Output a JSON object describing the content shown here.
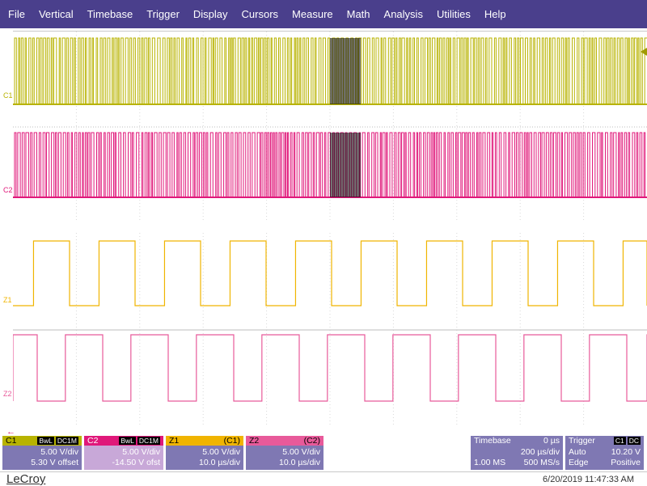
{
  "menu": [
    "File",
    "Vertical",
    "Timebase",
    "Trigger",
    "Display",
    "Cursors",
    "Measure",
    "Math",
    "Analysis",
    "Utilities",
    "Help"
  ],
  "colors": {
    "menubar": "#4a3f8c",
    "c1": "#b8b300",
    "c2": "#e0187a",
    "z1": "#f0b400",
    "z2": "#e85a9a",
    "box_body": "#7f78b3"
  },
  "traces": {
    "c1_label": "C1",
    "c2_label": "C2",
    "z1_label": "Z1",
    "z2_label": "Z2"
  },
  "icons": {
    "trigger_level_marker": "triangle-left-icon",
    "trigger_position_marker": "triangle-up-icon",
    "left_arrow": "arrow-left-icon"
  },
  "status": {
    "c1": {
      "name": "C1",
      "tag1": "BwL",
      "tag2": "DC1M",
      "vdiv": "5.00 V/div",
      "offset": "5.30 V offset"
    },
    "c2": {
      "name": "C2",
      "tag1": "BwL",
      "tag2": "DC1M",
      "vdiv": "5.00 V/div",
      "offset": "-14.50 V ofst"
    },
    "z1": {
      "name": "Z1",
      "source": "(C1)",
      "vdiv": "5.00 V/div",
      "tdiv": "10.0 µs/div"
    },
    "z2": {
      "name": "Z2",
      "source": "(C2)",
      "vdiv": "5.00 V/div",
      "tdiv": "10.0 µs/div"
    },
    "timebase": {
      "title": "Timebase",
      "delay": "0 µs",
      "tdiv": "200 µs/div",
      "samples": "1.00 MS",
      "rate": "500 MS/s"
    },
    "trigger": {
      "title": "Trigger",
      "tag": "C1",
      "coupling": "DC",
      "mode": "Auto",
      "level": "10.20 V",
      "type": "Edge",
      "slope": "Positive"
    }
  },
  "footer": {
    "brand": "LeCroy",
    "datetime": "6/20/2019 11:47:33 AM"
  }
}
